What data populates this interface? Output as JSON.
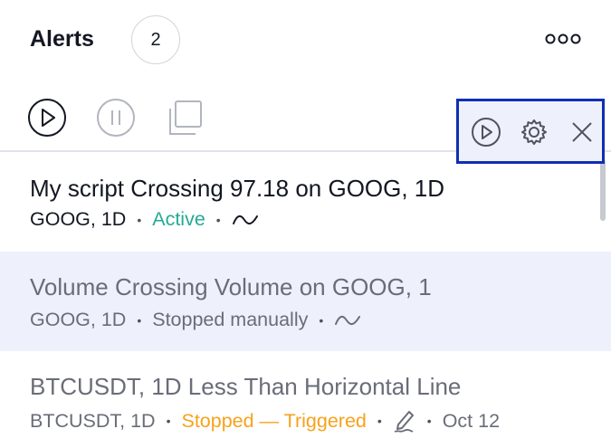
{
  "header": {
    "title": "Alerts",
    "count": "2"
  },
  "toolbar": {
    "icons": [
      "play-icon",
      "pause-icon",
      "clone-icon",
      "search-icon",
      "sort-icon"
    ]
  },
  "alerts": [
    {
      "title": "My script Crossing 97.18 on GOOG, 1D",
      "symbol": "GOOG, 1D",
      "status": "Active",
      "status_color": "#22ab94",
      "icon": "wave-icon"
    },
    {
      "title": "Volume Crossing Volume on GOOG, 1",
      "symbol": "GOOG, 1D",
      "status": "Stopped manually",
      "status_color": "#6a6d78",
      "icon": "wave-icon"
    },
    {
      "title": "BTCUSDT, 1D Less Than Horizontal Line",
      "symbol": "BTCUSDT, 1D",
      "status": "Stopped — Triggered",
      "status_color": "#f7a21b",
      "icon": "pencil-icon",
      "date": "Oct 12"
    }
  ],
  "colors": {
    "accent_border": "#0f2fb2",
    "highlight_bg": "#eef1fb"
  }
}
